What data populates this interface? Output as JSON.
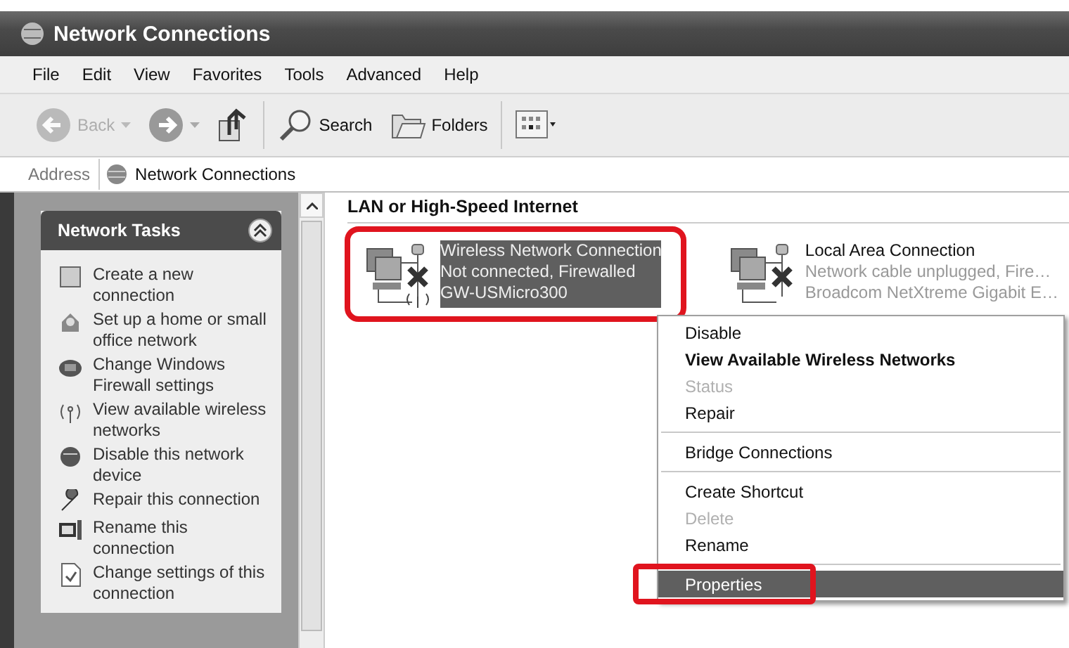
{
  "window": {
    "title": "Network Connections"
  },
  "menu_bar": [
    "File",
    "Edit",
    "View",
    "Favorites",
    "Tools",
    "Advanced",
    "Help"
  ],
  "toolbar": [
    {
      "kind": "back",
      "label": "Back",
      "disabled": true
    },
    {
      "kind": "forward",
      "disabled": false
    },
    {
      "kind": "up",
      "disabled": false
    },
    {
      "kind": "search",
      "label": "Search",
      "disabled": false
    },
    {
      "kind": "folders",
      "label": "Folders",
      "disabled": false
    },
    {
      "kind": "views",
      "disabled": false
    }
  ],
  "address": {
    "label": "Address",
    "value": "Network Connections"
  },
  "sidebar": {
    "title": "Network Tasks",
    "expanded": true,
    "items": [
      {
        "label": "Create a new connection"
      },
      {
        "label": "Set up a home or small office network"
      },
      {
        "label": "Change Windows Firewall settings"
      },
      {
        "label": "View available wireless networks"
      },
      {
        "label": "Disable this network device"
      },
      {
        "label": "Repair this connection"
      },
      {
        "label": "Rename this connection"
      },
      {
        "label": "Change settings of this connection"
      }
    ]
  },
  "group": {
    "title": "LAN or High-Speed Internet",
    "connections": [
      {
        "name": "Wireless Network Connection",
        "status": "Not connected, Firewalled",
        "device": "GW-USMicro300",
        "wireless": true,
        "selected": true,
        "annotated": true
      },
      {
        "name": "Local Area Connection",
        "status": "Network cable unplugged, Fire…",
        "device": "Broadcom NetXtreme Gigabit E…",
        "wireless": false,
        "selected": false,
        "annotated": false
      }
    ]
  },
  "context_menu": [
    {
      "kind": "item",
      "label": "Disable",
      "bold": false,
      "disabled": false,
      "selected": false,
      "annotated": false
    },
    {
      "kind": "item",
      "label": "View Available Wireless Networks",
      "bold": true,
      "disabled": false,
      "selected": false,
      "annotated": false
    },
    {
      "kind": "item",
      "label": "Status",
      "bold": false,
      "disabled": true,
      "selected": false,
      "annotated": false
    },
    {
      "kind": "item",
      "label": "Repair",
      "bold": false,
      "disabled": false,
      "selected": false,
      "annotated": false
    },
    {
      "kind": "separator"
    },
    {
      "kind": "item",
      "label": "Bridge Connections",
      "bold": false,
      "disabled": false,
      "selected": false,
      "annotated": false
    },
    {
      "kind": "separator"
    },
    {
      "kind": "item",
      "label": "Create Shortcut",
      "bold": false,
      "disabled": false,
      "selected": false,
      "annotated": false
    },
    {
      "kind": "item",
      "label": "Delete",
      "bold": false,
      "disabled": true,
      "selected": false,
      "annotated": false
    },
    {
      "kind": "item",
      "label": "Rename",
      "bold": false,
      "disabled": false,
      "selected": false,
      "annotated": false
    },
    {
      "kind": "separator"
    },
    {
      "kind": "item",
      "label": "Properties",
      "bold": false,
      "disabled": false,
      "selected": true,
      "annotated": true
    }
  ]
}
